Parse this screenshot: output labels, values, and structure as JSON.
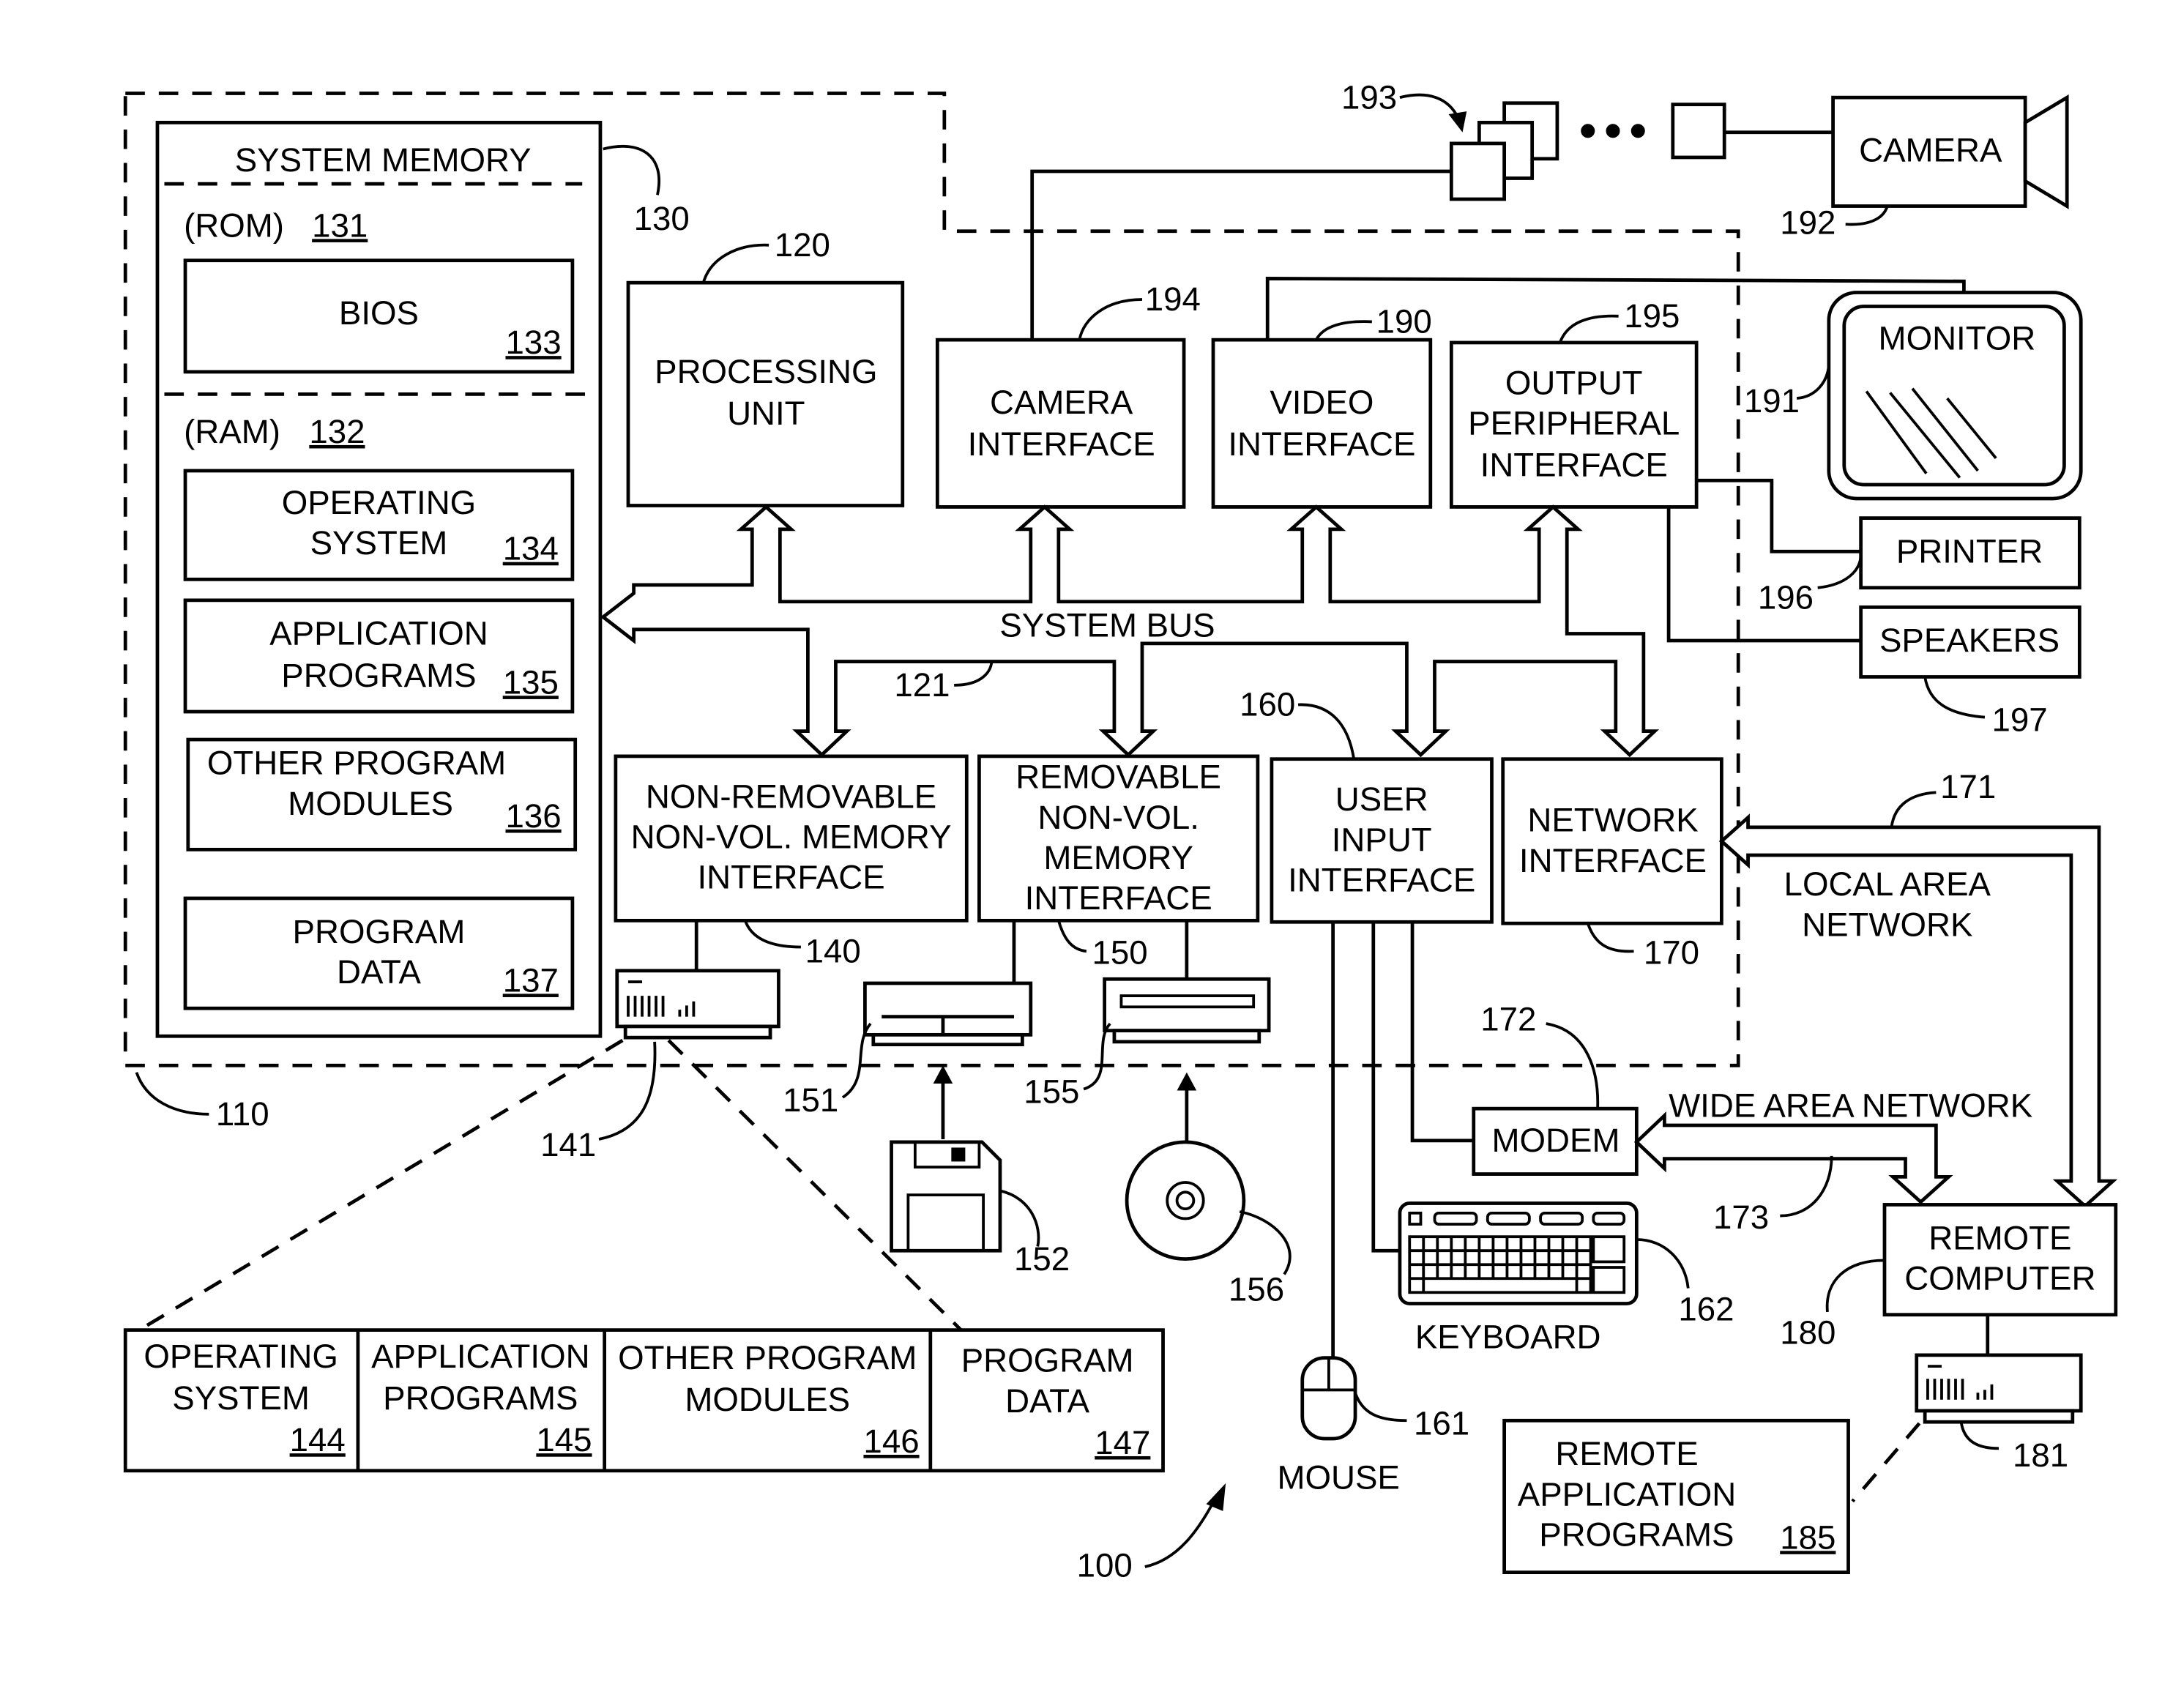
{
  "figure": {
    "ref_system": "100",
    "ref_computer": "110",
    "system_memory": {
      "title": "SYSTEM MEMORY",
      "ref": "130",
      "rom_label": "(ROM)",
      "rom_ref": "131",
      "ram_label": "(RAM)",
      "ram_ref": "132",
      "bios": {
        "label": "BIOS",
        "ref": "133"
      },
      "operating_system": {
        "line1": "OPERATING",
        "line2": "SYSTEM",
        "ref": "134"
      },
      "application_programs": {
        "line1": "APPLICATION",
        "line2": "PROGRAMS",
        "ref": "135"
      },
      "other_program_modules": {
        "line1": "OTHER PROGRAM",
        "line2": "MODULES",
        "ref": "136"
      },
      "program_data": {
        "line1": "PROGRAM",
        "line2": "DATA",
        "ref": "137"
      }
    },
    "processing_unit": {
      "line1": "PROCESSING",
      "line2": "UNIT",
      "ref": "120"
    },
    "camera_interface": {
      "line1": "CAMERA",
      "line2": "INTERFACE",
      "ref": "194"
    },
    "video_interface": {
      "line1": "VIDEO",
      "line2": "INTERFACE",
      "ref": "190"
    },
    "output_peripheral_interface": {
      "line1": "OUTPUT",
      "line2": "PERIPHERAL",
      "line3": "INTERFACE",
      "ref": "195"
    },
    "system_bus": {
      "label": "SYSTEM BUS",
      "ref": "121"
    },
    "non_removable_interface": {
      "line1": "NON-REMOVABLE",
      "line2": "NON-VOL. MEMORY",
      "line3": "INTERFACE",
      "ref": "140"
    },
    "removable_interface": {
      "line1": "REMOVABLE",
      "line2": "NON-VOL.",
      "line3": "MEMORY",
      "line4": "INTERFACE",
      "ref": "150"
    },
    "user_input_interface": {
      "line1": "USER",
      "line2": "INPUT",
      "line3": "INTERFACE",
      "ref": "160"
    },
    "network_interface": {
      "line1": "NETWORK",
      "line2": "INTERFACE",
      "ref": "170"
    },
    "camera": {
      "label": "CAMERA",
      "ref": "192",
      "images_ref": "193"
    },
    "monitor": {
      "label": "MONITOR",
      "ref": "191"
    },
    "printer": {
      "label": "PRINTER",
      "ref": "196"
    },
    "speakers": {
      "label": "SPEAKERS",
      "ref": "197"
    },
    "lan": {
      "line1": "LOCAL AREA",
      "line2": "NETWORK",
      "ref": "171"
    },
    "wan": {
      "label": "WIDE AREA NETWORK",
      "ref": "173"
    },
    "modem": {
      "label": "MODEM",
      "ref": "172"
    },
    "keyboard": {
      "label": "KEYBOARD",
      "ref": "162"
    },
    "mouse": {
      "label": "MOUSE",
      "ref": "161"
    },
    "remote_computer": {
      "line1": "REMOTE",
      "line2": "COMPUTER",
      "ref": "180"
    },
    "remote_storage": {
      "ref": "181"
    },
    "remote_apps": {
      "line1": "REMOTE",
      "line2": "APPLICATION",
      "line3": "PROGRAMS",
      "ref": "185"
    },
    "hard_disk": {
      "ref": "141"
    },
    "floppy_drive": {
      "ref": "151"
    },
    "floppy_disk": {
      "ref": "152"
    },
    "optical_drive": {
      "ref": "155"
    },
    "optical_disk": {
      "ref": "156"
    },
    "disk_contents": [
      {
        "line1": "OPERATING",
        "line2": "SYSTEM",
        "ref": "144"
      },
      {
        "line1": "APPLICATION",
        "line2": "PROGRAMS",
        "ref": "145"
      },
      {
        "line1": "OTHER PROGRAM",
        "line2": "MODULES",
        "ref": "146"
      },
      {
        "line1": "PROGRAM",
        "line2": "DATA",
        "ref": "147"
      }
    ]
  }
}
